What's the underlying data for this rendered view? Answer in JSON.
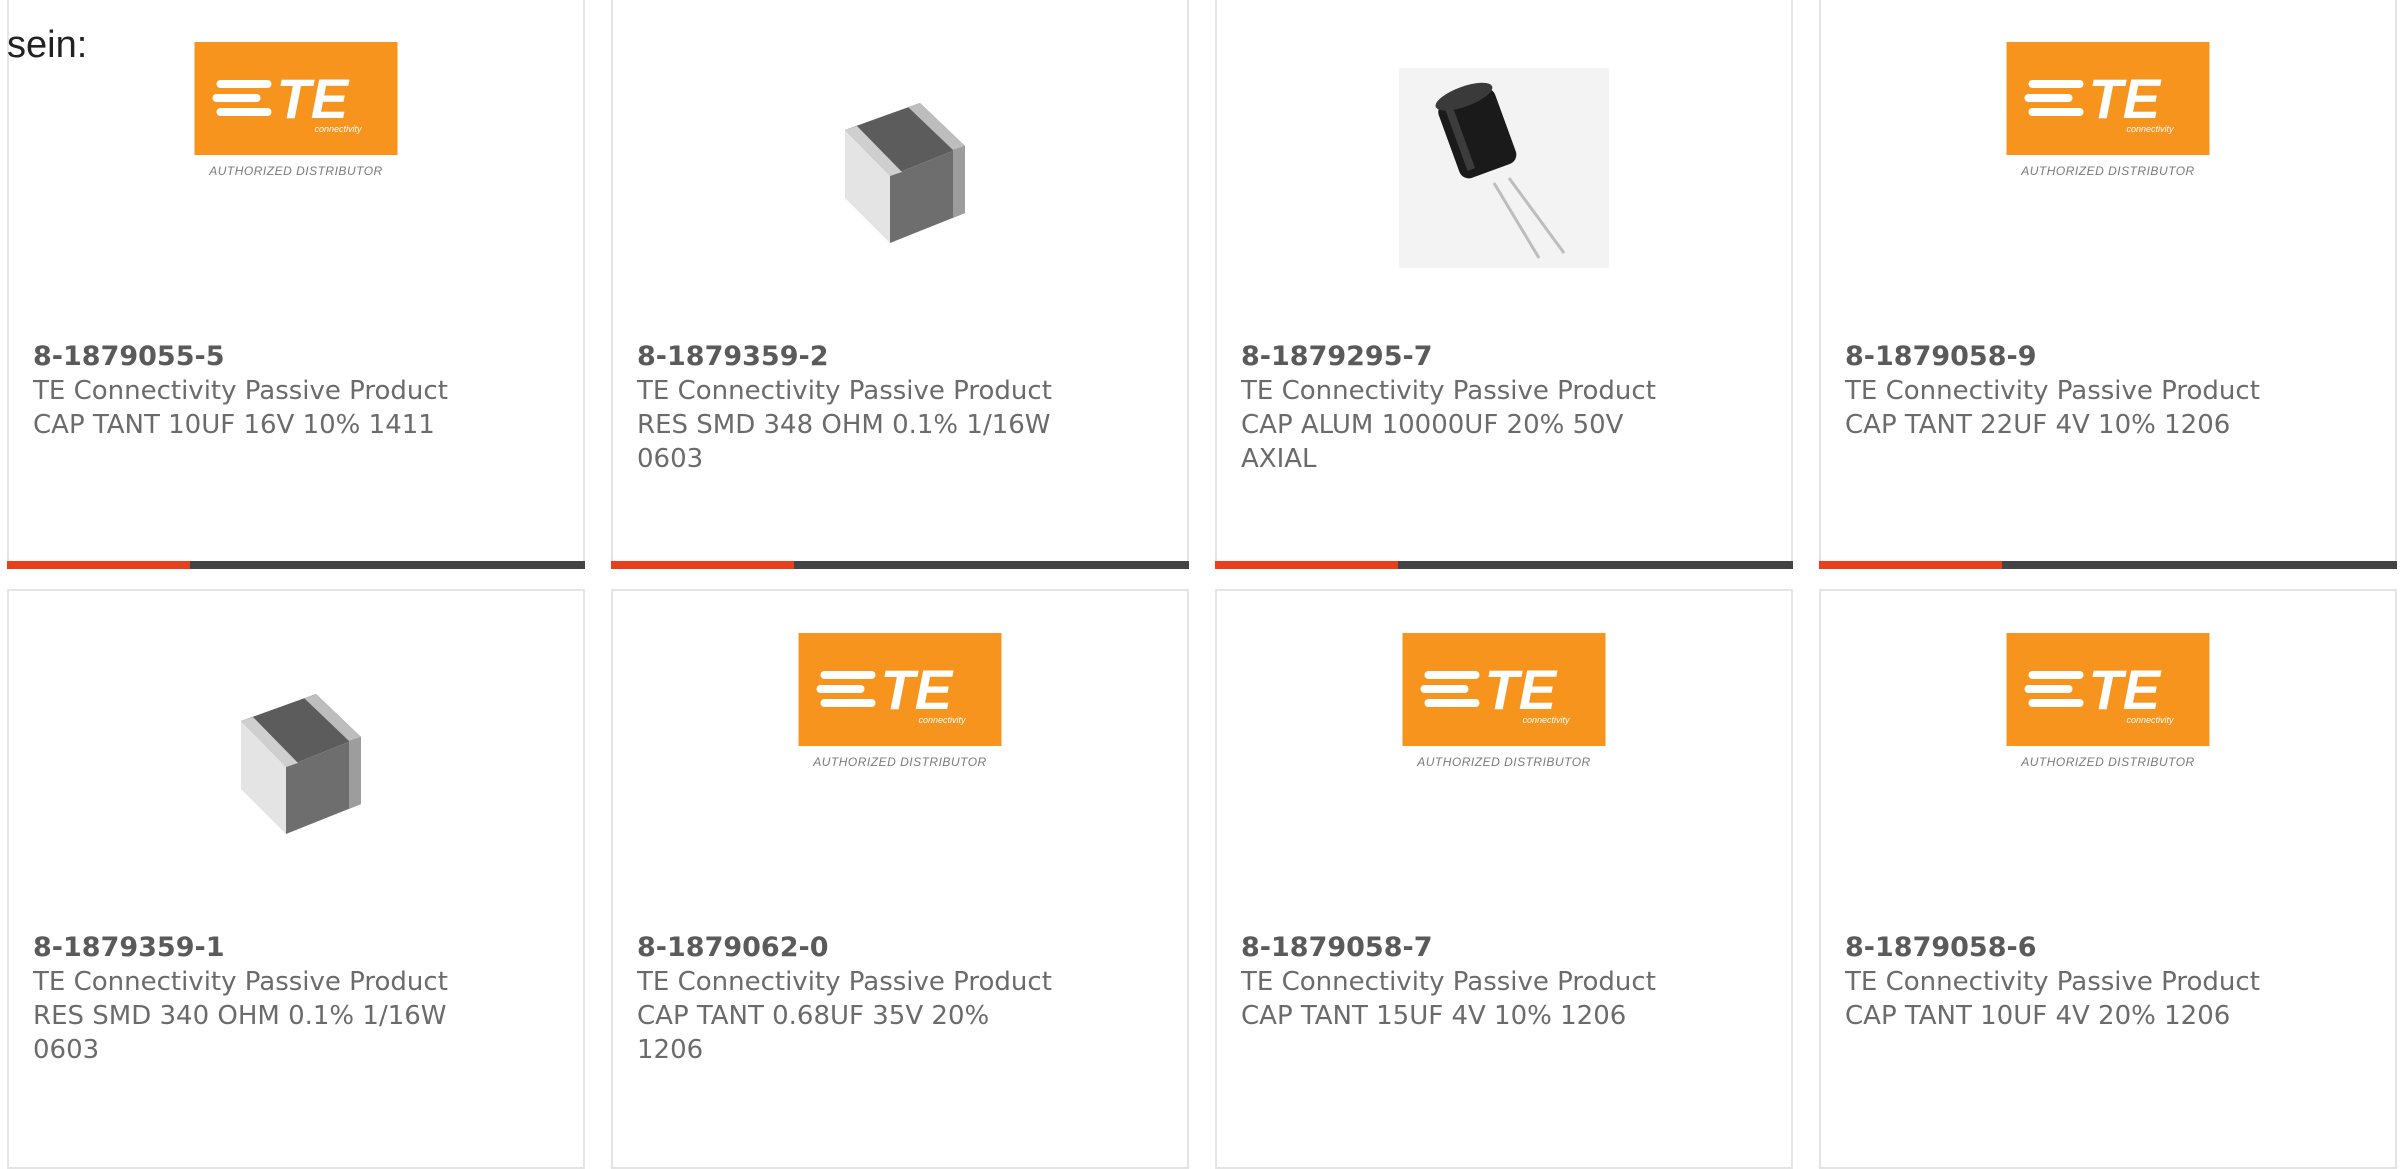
{
  "intro_text": "sein:",
  "logo": {
    "caption": "AUTHORIZED DISTRIBUTOR",
    "wordmark": "TE",
    "tagline": "connectivity",
    "color": "#f7941d"
  },
  "accent_color": "#e8401c",
  "products": [
    {
      "pn": "8-1879055-5",
      "brand": "TE Connectivity Passive Product",
      "desc": "CAP TANT 10UF 16V 10% 1411",
      "image": "te-logo"
    },
    {
      "pn": "8-1879359-2",
      "brand": "TE Connectivity Passive Product",
      "desc": "RES SMD 348 OHM 0.1% 1/16W 0603",
      "image": "smd-resistor"
    },
    {
      "pn": "8-1879295-7",
      "brand": "TE Connectivity Passive Product",
      "desc": "CAP ALUM 10000UF 20% 50V AXIAL",
      "image": "electrolytic-capacitor"
    },
    {
      "pn": "8-1879058-9",
      "brand": "TE Connectivity Passive Product",
      "desc": "CAP TANT 22UF 4V 10% 1206",
      "image": "te-logo"
    },
    {
      "pn": "8-1879359-1",
      "brand": "TE Connectivity Passive Product",
      "desc": "RES SMD 340 OHM 0.1% 1/16W 0603",
      "image": "smd-resistor"
    },
    {
      "pn": "8-1879062-0",
      "brand": "TE Connectivity Passive Product",
      "desc": "CAP TANT 0.68UF 35V 20% 1206",
      "image": "te-logo"
    },
    {
      "pn": "8-1879058-7",
      "brand": "TE Connectivity Passive Product",
      "desc": "CAP TANT 15UF 4V 10% 1206",
      "image": "te-logo"
    },
    {
      "pn": "8-1879058-6",
      "brand": "TE Connectivity Passive Product",
      "desc": "CAP TANT 10UF 4V 20% 1206",
      "image": "te-logo"
    }
  ]
}
